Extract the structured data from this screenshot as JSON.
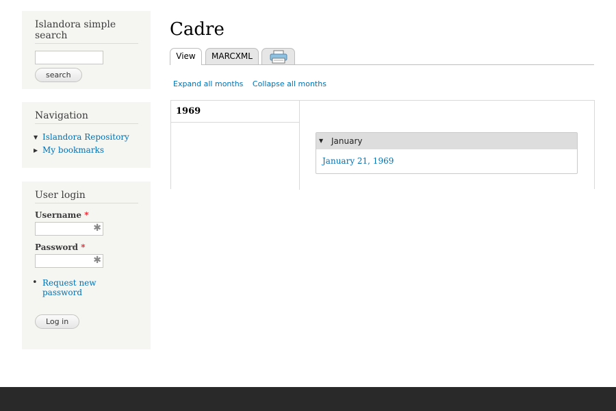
{
  "search_block": {
    "title": "Islandora simple search",
    "input_value": "",
    "button_label": "search"
  },
  "navigation": {
    "title": "Navigation",
    "items": [
      {
        "label": "Islandora Repository",
        "state": "expanded"
      },
      {
        "label": "My bookmarks",
        "state": "collapsed"
      }
    ]
  },
  "login": {
    "title": "User login",
    "username_label": "Username",
    "password_label": "Password",
    "required_mark": "*",
    "field_asterisk": "✱",
    "request_password": "Request new password",
    "login_button": "Log in"
  },
  "page": {
    "title": "Cadre",
    "tabs": [
      {
        "label": "View"
      },
      {
        "label": "MARCXML"
      },
      {
        "label": "print-icon"
      }
    ],
    "expand_all": "Expand all months",
    "collapse_all": "Collapse all months",
    "year": "1969",
    "month": "January",
    "date_link": "January 21, 1969"
  },
  "colors": {
    "link": "#0071b3",
    "sidebar_bg": "#f5f5f1",
    "footer_bg": "#292929",
    "required": "#e8202a"
  }
}
